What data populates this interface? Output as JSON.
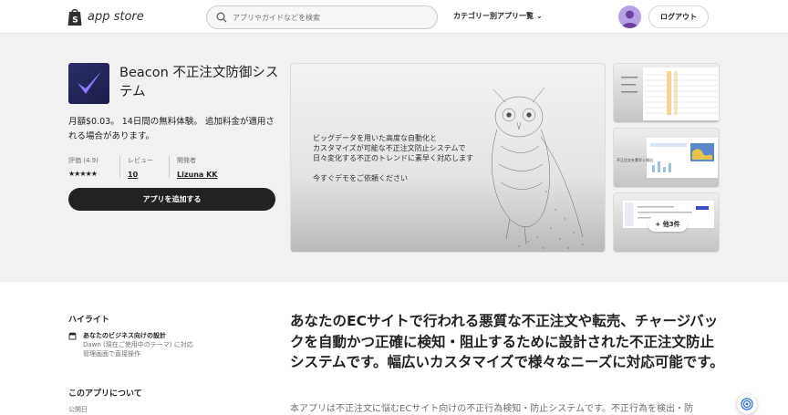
{
  "header": {
    "logo_text": "app store",
    "search_placeholder": "アプリやガイドなどを検索",
    "categories_label": "カテゴリー別アプリ一覧",
    "logout_label": "ログアウト"
  },
  "app": {
    "title": "Beacon 不正注文防御システム",
    "pricing": "月額$0.03。 14日間の無料体験。 追加料金が適用される場合があります。",
    "rating_label": "評価 (4.9)",
    "stars": "★★★★★",
    "reviews_label": "レビュー",
    "reviews_count": "10",
    "developer_label": "開発者",
    "developer_name": "Lizuna KK",
    "add_button": "アプリを追加する"
  },
  "media": {
    "main_line1": "ビッグデータを用いた高度な自動化と",
    "main_line2": "カスタマイズが可能な不正注文防止システムで",
    "main_line3": "日々変化する不正のトレンドに素早く対応します",
    "main_cta": "今すぐデモをご依頼ください",
    "thumb2_text": "不正注文を素早く検出",
    "more_label": "+ 他3件"
  },
  "highlights": {
    "title": "ハイライト",
    "item_head": "あなたのビジネス向けの設計",
    "item_sub1": "Dawn (現在ご使用中のテーマ) に対応",
    "item_sub2": "管理画面で直接操作"
  },
  "about": {
    "title": "このアプリについて",
    "published_label": "公開日"
  },
  "description": {
    "headline": "あなたのECサイトで行われる悪質な不正注文や転売、チャージバックを自動かつ正確に検知・阻止するために設計された不正注文防止システムです。幅広いカスタマイズで様々なニーズに対応可能です。",
    "body": "本アプリは不正注文に悩むECサイト向けの不正行為検知・防止システムです。不正行為を検出・防"
  }
}
